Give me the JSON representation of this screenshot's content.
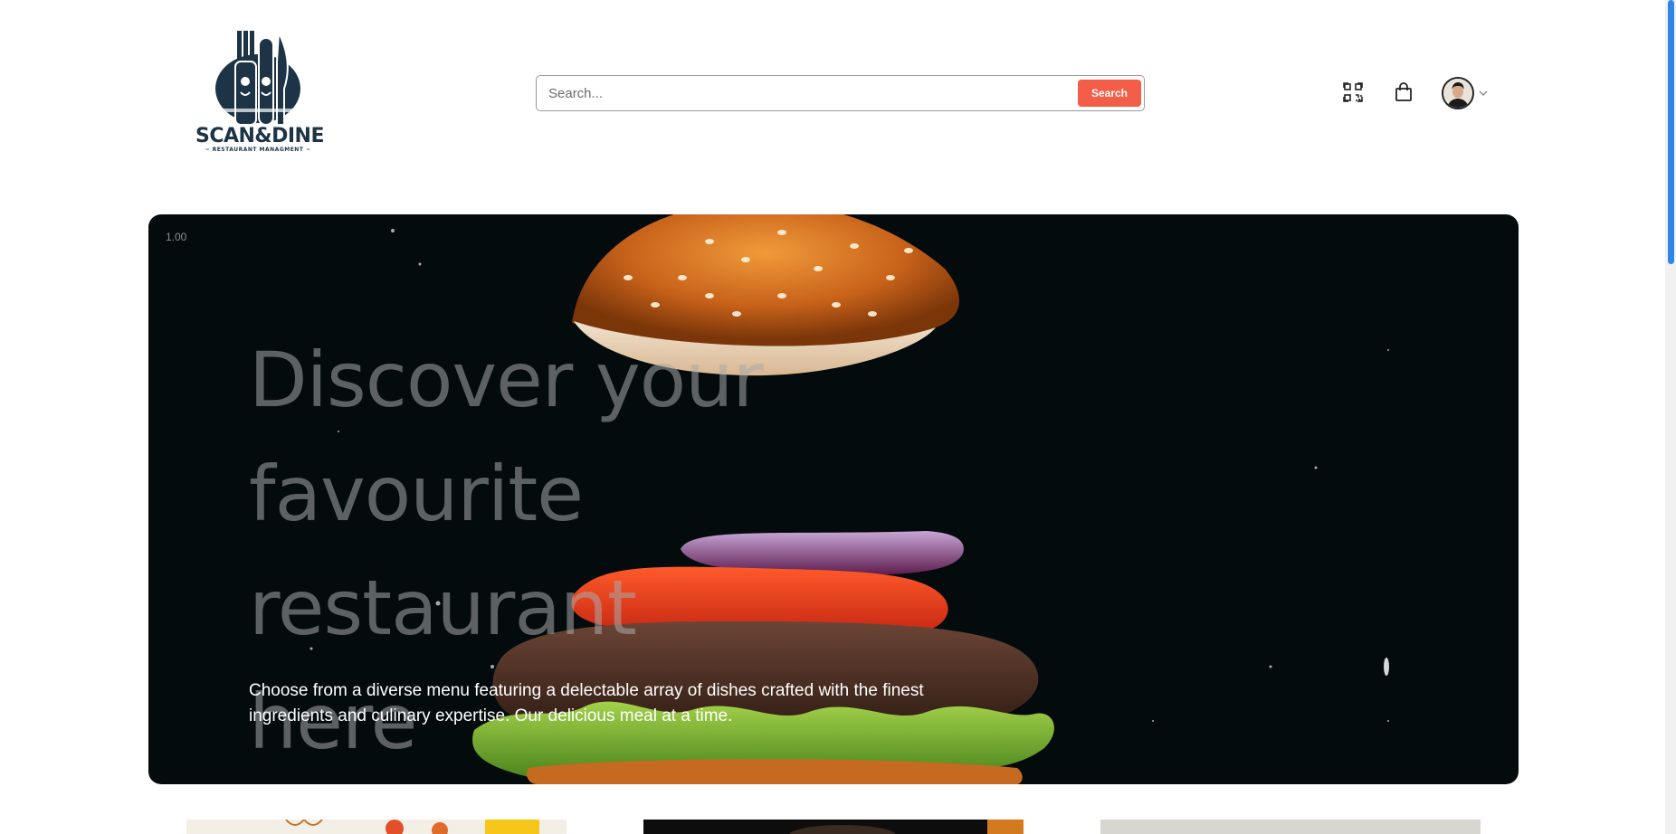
{
  "brand": {
    "name": "SCAN&DINE",
    "tagline": "~ RESTAURANT MANAGMENT ~"
  },
  "search": {
    "placeholder": "Search...",
    "button_label": "Search"
  },
  "header_icons": [
    "qr-code-scan-icon",
    "shopping-bag-icon",
    "user-avatar",
    "chevron-down-icon"
  ],
  "hero": {
    "playback_rate": "1.00",
    "title_lines": [
      "Discover your",
      "favourite restaurant",
      "here"
    ],
    "description": "Choose from a diverse menu featuring a delectable array of dishes crafted with the finest ingredients and culinary expertise. Our delicious meal at a time."
  },
  "colors": {
    "accent": "#f45d48",
    "brand_dark": "#1d3447",
    "hero_bg": "#040b0d",
    "scrollbar_thumb": "#2f86e6"
  }
}
